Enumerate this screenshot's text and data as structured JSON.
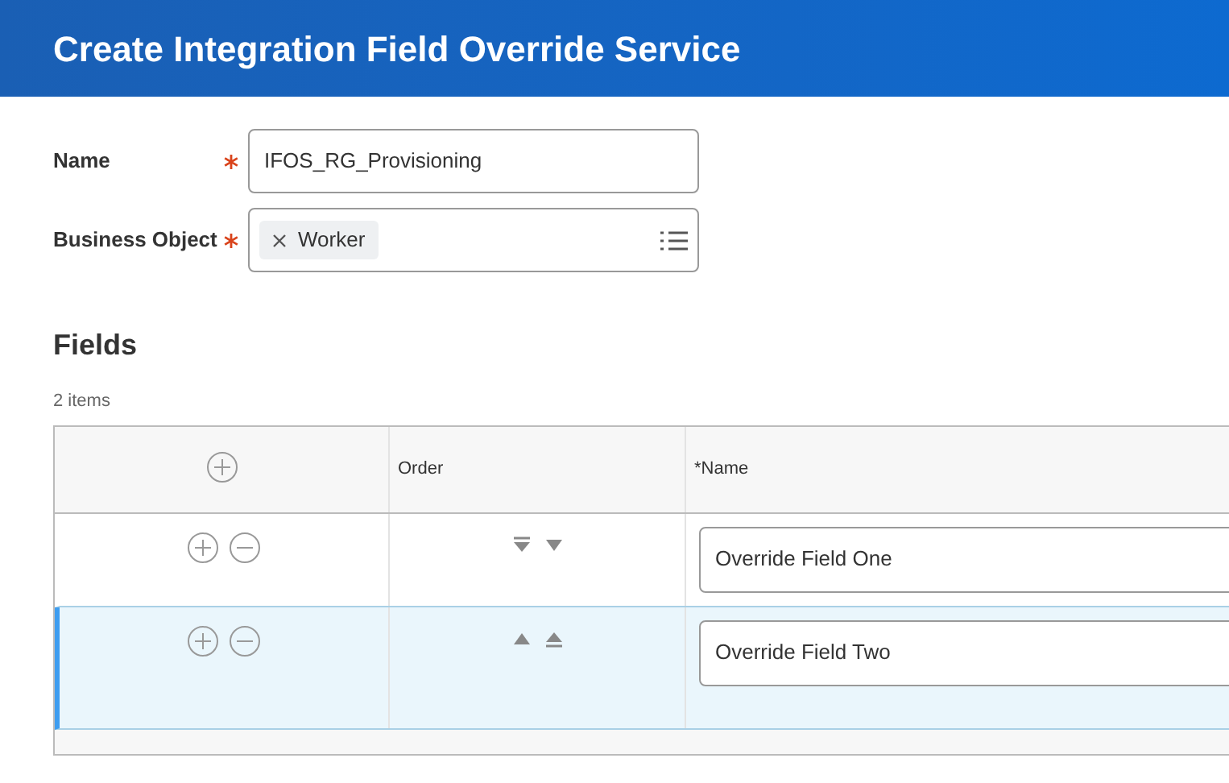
{
  "header": {
    "title": "Create Integration Field Override Service"
  },
  "form": [
    {
      "kind": "text",
      "label": "Name",
      "required": true,
      "value": "IFOS_RG_Provisioning"
    },
    {
      "kind": "multiselect",
      "label": "Business Object",
      "required": true,
      "tokens": [
        "Worker"
      ]
    }
  ],
  "section": {
    "title": "Fields",
    "count": "2 items"
  },
  "table": {
    "columns": [
      "Order",
      "*Name"
    ],
    "rows": [
      {
        "selected": false,
        "order_buttons": [
          {
            "kind": "to_bottom"
          },
          {
            "kind": "down"
          }
        ],
        "name": "Override Field One"
      },
      {
        "selected": true,
        "order_buttons": [
          {
            "kind": "up"
          },
          {
            "kind": "to_top"
          }
        ],
        "name": "Override Field Two"
      }
    ]
  }
}
